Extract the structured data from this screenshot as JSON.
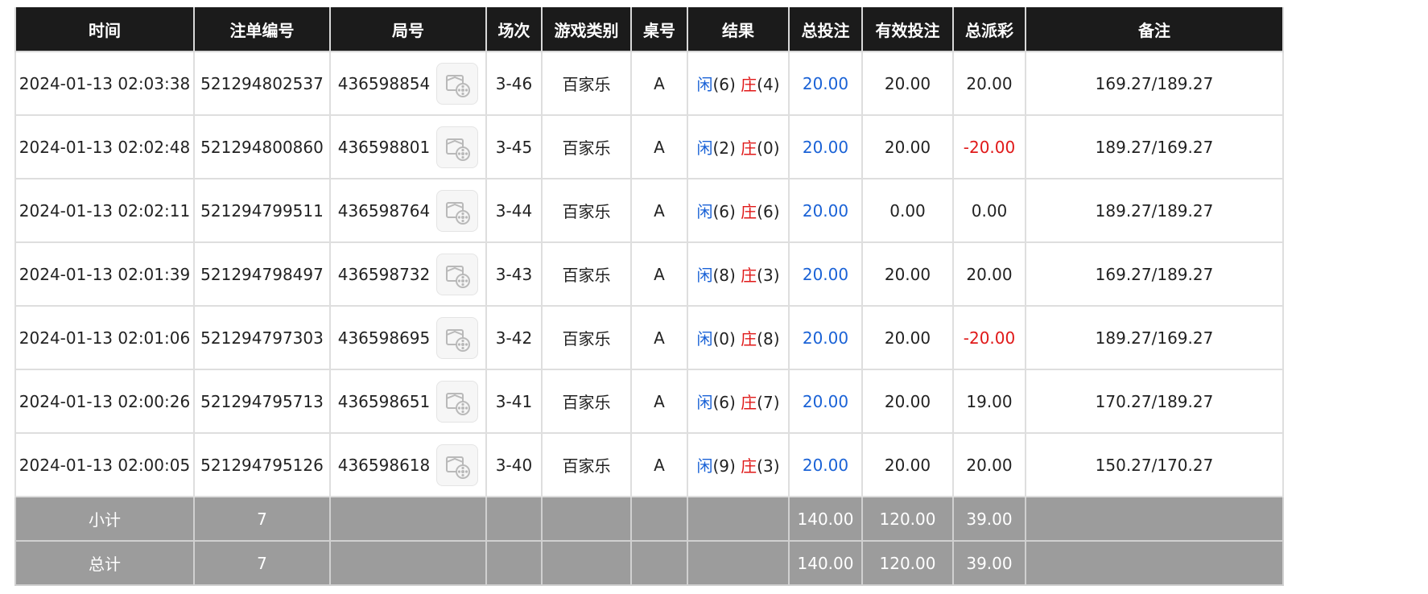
{
  "headers": [
    "时间",
    "注单编号",
    "局号",
    "场次",
    "游戏类别",
    "桌号",
    "结果",
    "总投注",
    "有效投注",
    "总派彩",
    "备注"
  ],
  "result_labels": {
    "player": "闲",
    "banker": "庄"
  },
  "rows": [
    {
      "time": "2024-01-13 02:03:38",
      "bet_id": "521294802537",
      "round": "436598854",
      "shoe": "3-46",
      "game": "百家乐",
      "table": "A",
      "player": "(6)",
      "banker": "(4)",
      "total_bet": "20.00",
      "valid_bet": "20.00",
      "payout": "20.00",
      "payout_negative": false,
      "note": "169.27/189.27"
    },
    {
      "time": "2024-01-13 02:02:48",
      "bet_id": "521294800860",
      "round": "436598801",
      "shoe": "3-45",
      "game": "百家乐",
      "table": "A",
      "player": "(2)",
      "banker": "(0)",
      "total_bet": "20.00",
      "valid_bet": "20.00",
      "payout": "-20.00",
      "payout_negative": true,
      "note": "189.27/169.27"
    },
    {
      "time": "2024-01-13 02:02:11",
      "bet_id": "521294799511",
      "round": "436598764",
      "shoe": "3-44",
      "game": "百家乐",
      "table": "A",
      "player": "(6)",
      "banker": "(6)",
      "total_bet": "20.00",
      "valid_bet": "0.00",
      "payout": "0.00",
      "payout_negative": false,
      "note": "189.27/189.27"
    },
    {
      "time": "2024-01-13 02:01:39",
      "bet_id": "521294798497",
      "round": "436598732",
      "shoe": "3-43",
      "game": "百家乐",
      "table": "A",
      "player": "(8)",
      "banker": "(3)",
      "total_bet": "20.00",
      "valid_bet": "20.00",
      "payout": "20.00",
      "payout_negative": false,
      "note": "169.27/189.27"
    },
    {
      "time": "2024-01-13 02:01:06",
      "bet_id": "521294797303",
      "round": "436598695",
      "shoe": "3-42",
      "game": "百家乐",
      "table": "A",
      "player": "(0)",
      "banker": "(8)",
      "total_bet": "20.00",
      "valid_bet": "20.00",
      "payout": "-20.00",
      "payout_negative": true,
      "note": "189.27/169.27"
    },
    {
      "time": "2024-01-13 02:00:26",
      "bet_id": "521294795713",
      "round": "436598651",
      "shoe": "3-41",
      "game": "百家乐",
      "table": "A",
      "player": "(6)",
      "banker": "(7)",
      "total_bet": "20.00",
      "valid_bet": "20.00",
      "payout": "19.00",
      "payout_negative": false,
      "note": "170.27/189.27"
    },
    {
      "time": "2024-01-13 02:00:05",
      "bet_id": "521294795126",
      "round": "436598618",
      "shoe": "3-40",
      "game": "百家乐",
      "table": "A",
      "player": "(9)",
      "banker": "(3)",
      "total_bet": "20.00",
      "valid_bet": "20.00",
      "payout": "20.00",
      "payout_negative": false,
      "note": "150.27/170.27"
    }
  ],
  "summary": [
    {
      "label": "小计",
      "count": "7",
      "total_bet": "140.00",
      "valid_bet": "120.00",
      "payout": "39.00"
    },
    {
      "label": "总计",
      "count": "7",
      "total_bet": "140.00",
      "valid_bet": "120.00",
      "payout": "39.00"
    }
  ],
  "colors": {
    "header_bg": "#1b1b1b",
    "summary_bg": "#9c9c9c",
    "player_blue": "#1a62d6",
    "banker_red": "#e01919"
  },
  "icons": {
    "replay": "video-replay-icon"
  }
}
